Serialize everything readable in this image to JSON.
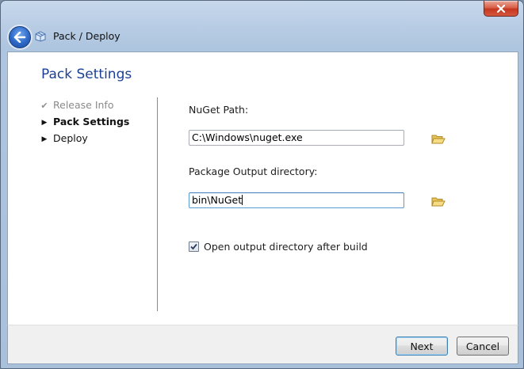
{
  "window": {
    "close_icon": "close-icon",
    "close_color": "#c4381f",
    "nav": {
      "back_icon": "back-arrow-icon",
      "app_icon": "package-icon",
      "title": "Pack / Deploy"
    }
  },
  "page": {
    "title": "Pack Settings",
    "title_color": "#1c3f94"
  },
  "steps": [
    {
      "label": "Release Info",
      "state": "done",
      "marker_icon": "checkmark-icon",
      "marker": "✔"
    },
    {
      "label": "Pack Settings",
      "state": "current",
      "marker_icon": "triangle-right-icon",
      "marker": "▶"
    },
    {
      "label": "Deploy",
      "state": "next",
      "marker_icon": "triangle-right-icon",
      "marker": "▶"
    }
  ],
  "form": {
    "nuget_path_label": "NuGet Path:",
    "nuget_path_value": "C:\\Windows\\nuget.exe",
    "output_dir_label": "Package Output directory:",
    "output_dir_value": "bin\\NuGet",
    "browse_icon": "folder-open-icon",
    "open_after_build_label": "Open output directory after build",
    "open_after_build_checked": true
  },
  "footer": {
    "next_label": "Next",
    "cancel_label": "Cancel"
  }
}
